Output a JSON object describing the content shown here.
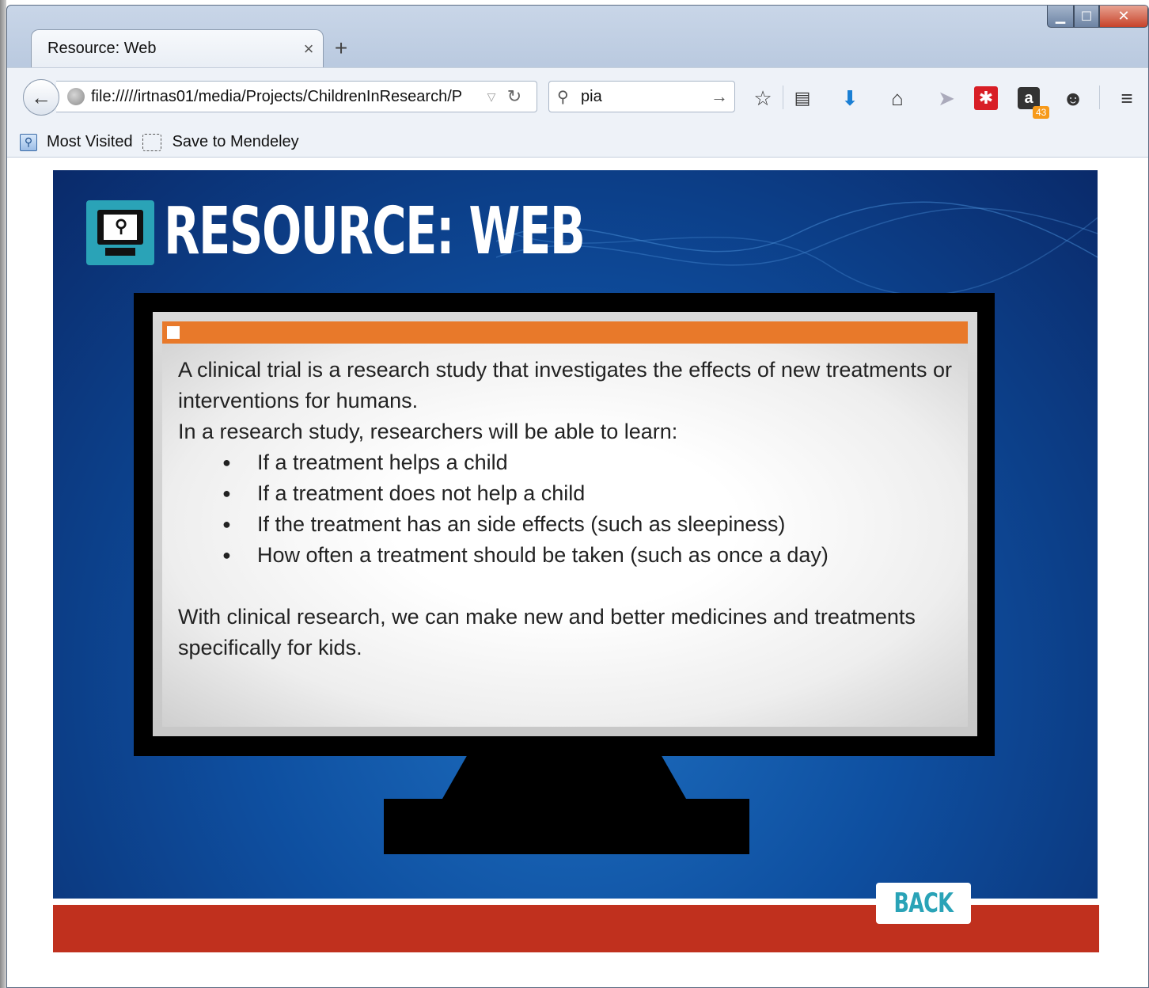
{
  "browser": {
    "tab_title": "Resource: Web",
    "tab_close": "×",
    "new_tab": "+",
    "url": "file://///irtnas01/media/Projects/ChildrenInResearch/P",
    "search_value": "pia",
    "badge_count": "43",
    "bookmarks": [
      {
        "label": "Most Visited"
      },
      {
        "label": "Save to Mendeley"
      }
    ]
  },
  "slide": {
    "title": "RESOURCE: WEB",
    "paragraph1": "A clinical trial is a research study that investigates the effects of new treatments or interventions for humans.",
    "paragraph2": "In a research study, researchers will be able to learn:",
    "bullets": [
      "If a treatment helps a child",
      "If a treatment does not help a child",
      "If the treatment has an side effects (such as sleepiness)",
      "How often a treatment should be taken (such as once a day)"
    ],
    "paragraph3": "With clinical research, we can make new and better medicines and treatments specifically for kids.",
    "back_label": "BACK"
  },
  "colors": {
    "slide_blue": "#0e4fa0",
    "accent_orange": "#e8792a",
    "footer_red": "#c0301e",
    "teal": "#2aa3b7"
  },
  "icons": [
    "back-arrow-icon",
    "globe-icon",
    "dropdown-icon",
    "reload-icon",
    "search-icon",
    "go-arrow-icon",
    "star-icon",
    "reading-list-icon",
    "download-icon",
    "home-icon",
    "send-icon",
    "addon-red-icon",
    "amazon-icon",
    "chat-icon",
    "menu-icon",
    "bookmark-icon",
    "monitor-search-icon"
  ]
}
